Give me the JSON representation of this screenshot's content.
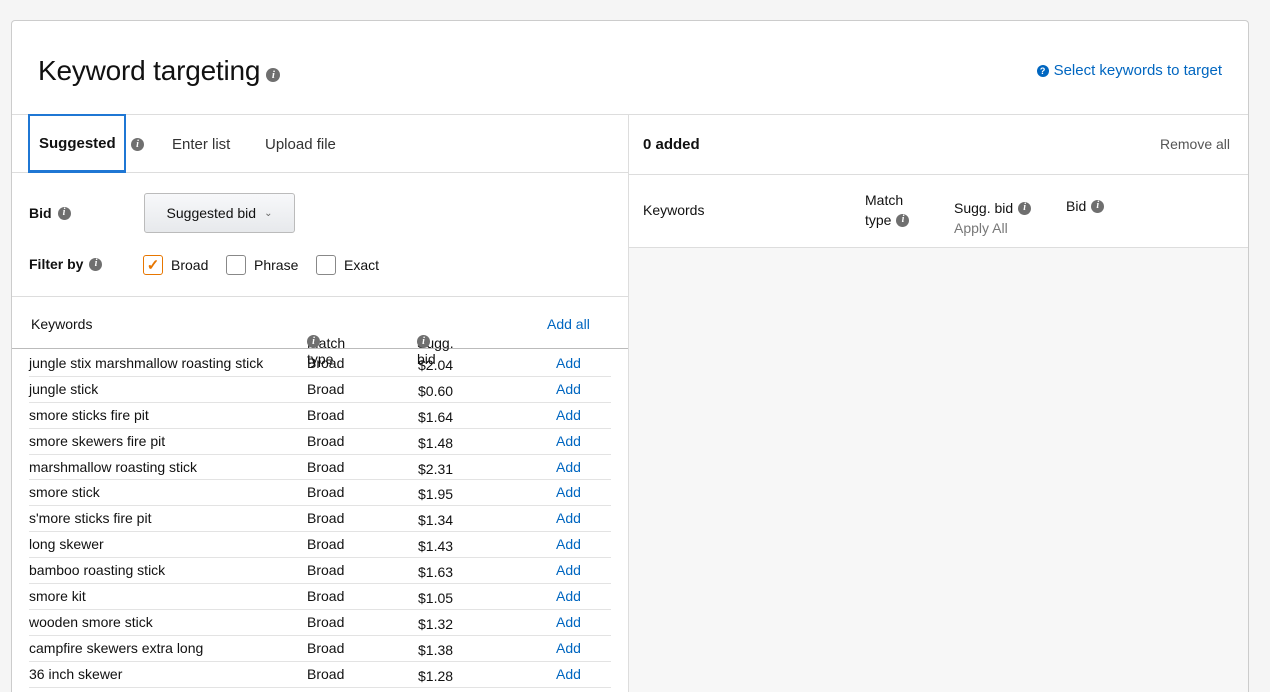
{
  "header": {
    "title": "Keyword targeting",
    "help_link": "Select keywords to target"
  },
  "tabs": {
    "suggested": "Suggested",
    "enter_list": "Enter list",
    "upload_file": "Upload file"
  },
  "filters": {
    "bid_label": "Bid",
    "bid_dropdown": "Suggested bid",
    "filter_label": "Filter by",
    "options": [
      {
        "label": "Broad",
        "checked": true
      },
      {
        "label": "Phrase",
        "checked": false
      },
      {
        "label": "Exact",
        "checked": false
      }
    ]
  },
  "keyword_table": {
    "headers": {
      "keywords": "Keywords",
      "match_type": "Match type",
      "sugg_bid": "Sugg. bid",
      "add_all": "Add all"
    },
    "add_label": "Add",
    "rows": [
      {
        "keyword": "jungle stix marshmallow roasting stick",
        "match": "Broad",
        "bid": "$2.04"
      },
      {
        "keyword": "jungle stick",
        "match": "Broad",
        "bid": "$0.60"
      },
      {
        "keyword": "smore sticks fire pit",
        "match": "Broad",
        "bid": "$1.64"
      },
      {
        "keyword": "smore skewers fire pit",
        "match": "Broad",
        "bid": "$1.48"
      },
      {
        "keyword": "marshmallow roasting stick",
        "match": "Broad",
        "bid": "$2.31"
      },
      {
        "keyword": "smore stick",
        "match": "Broad",
        "bid": "$1.95"
      },
      {
        "keyword": "s'more sticks fire pit",
        "match": "Broad",
        "bid": "$1.34"
      },
      {
        "keyword": "long skewer",
        "match": "Broad",
        "bid": "$1.43"
      },
      {
        "keyword": "bamboo roasting stick",
        "match": "Broad",
        "bid": "$1.63"
      },
      {
        "keyword": "smore kit",
        "match": "Broad",
        "bid": "$1.05"
      },
      {
        "keyword": "wooden smore stick",
        "match": "Broad",
        "bid": "$1.32"
      },
      {
        "keyword": "campfire skewers extra long",
        "match": "Broad",
        "bid": "$1.38"
      },
      {
        "keyword": "36 inch skewer",
        "match": "Broad",
        "bid": "$1.28"
      }
    ]
  },
  "selected": {
    "added_count": "0 added",
    "remove_all": "Remove all",
    "headers": {
      "keywords": "Keywords",
      "match_line1": "Match",
      "match_line2": "type",
      "sugg_bid": "Sugg. bid",
      "apply_all": "Apply All",
      "bid": "Bid"
    }
  }
}
